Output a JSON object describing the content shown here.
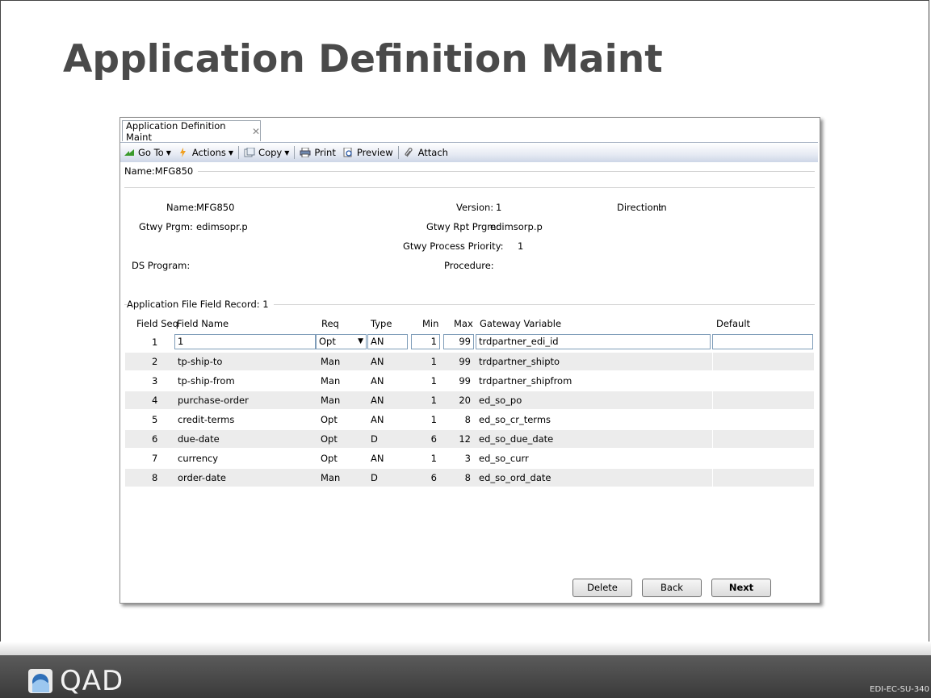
{
  "slide": {
    "title": "Application Definition Maint",
    "code": "EDI-EC-SU-340",
    "logo_text": "QAD"
  },
  "tab": {
    "label": "Application Definition Maint",
    "close": "✕"
  },
  "toolbar": {
    "goto": "Go To",
    "actions": "Actions",
    "copy": "Copy",
    "print": "Print",
    "preview": "Preview",
    "attach": "Attach"
  },
  "header_section": "Name:MFG850",
  "form": {
    "name_label": "Name:",
    "name": "MFG850",
    "version_label": "Version:",
    "version": "1",
    "direction_label": "Direction:",
    "direction": "In",
    "gtwy_prgm_label": "Gtwy Prgm:",
    "gtwy_prgm": "edimsopr.p",
    "gtwy_rpt_label": "Gtwy Rpt Prgm:",
    "gtwy_rpt": "edimsorp.p",
    "priority_label": "Gtwy Process Priority:",
    "priority": "1",
    "ds_program_label": "DS Program:",
    "procedure_label": "Procedure:"
  },
  "record_section": "Application File Field Record: 1",
  "columns": {
    "seq": "Field Seq",
    "name": "Field Name",
    "req": "Req",
    "type": "Type",
    "min": "Min",
    "max": "Max",
    "var": "Gateway Variable",
    "def": "Default"
  },
  "rows": [
    {
      "seq": "1",
      "name": "1",
      "req": "Opt",
      "type": "AN",
      "min": "1",
      "max": "99",
      "var": "trdpartner_edi_id",
      "def": ""
    },
    {
      "seq": "2",
      "name": "tp-ship-to",
      "req": "Man",
      "type": "AN",
      "min": "1",
      "max": "99",
      "var": "trdpartner_shipto",
      "def": ""
    },
    {
      "seq": "3",
      "name": "tp-ship-from",
      "req": "Man",
      "type": "AN",
      "min": "1",
      "max": "99",
      "var": "trdpartner_shipfrom",
      "def": ""
    },
    {
      "seq": "4",
      "name": "purchase-order",
      "req": "Man",
      "type": "AN",
      "min": "1",
      "max": "20",
      "var": "ed_so_po",
      "def": ""
    },
    {
      "seq": "5",
      "name": "credit-terms",
      "req": "Opt",
      "type": "AN",
      "min": "1",
      "max": "8",
      "var": "ed_so_cr_terms",
      "def": ""
    },
    {
      "seq": "6",
      "name": "due-date",
      "req": "Opt",
      "type": "D",
      "min": "6",
      "max": "12",
      "var": "ed_so_due_date",
      "def": ""
    },
    {
      "seq": "7",
      "name": "currency",
      "req": "Opt",
      "type": "AN",
      "min": "1",
      "max": "3",
      "var": "ed_so_curr",
      "def": ""
    },
    {
      "seq": "8",
      "name": "order-date",
      "req": "Man",
      "type": "D",
      "min": "6",
      "max": "8",
      "var": "ed_so_ord_date",
      "def": ""
    }
  ],
  "buttons": {
    "delete": "Delete",
    "back": "Back",
    "next": "Next"
  }
}
